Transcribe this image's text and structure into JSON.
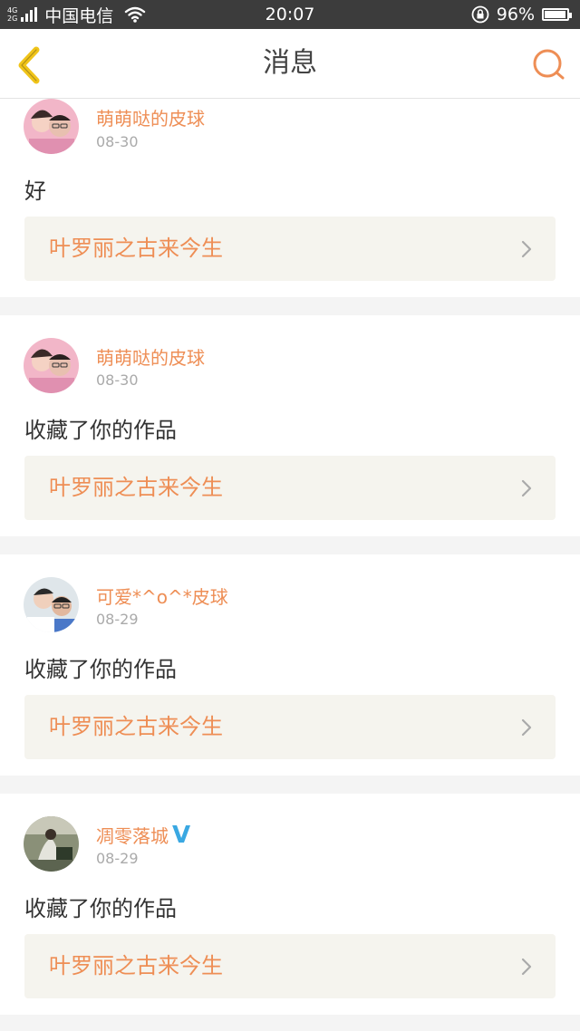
{
  "status_bar": {
    "network_top": "4G",
    "network_bottom": "2G",
    "carrier": "中国电信",
    "time": "20:07",
    "battery": "96%",
    "battery_level": 0.96
  },
  "header": {
    "title": "消息",
    "back_icon": "chevron-left-icon",
    "search_icon": "search-icon"
  },
  "colors": {
    "accent": "#ee8e55",
    "back_icon": "#f0c419",
    "verified": "#3aa8e2"
  },
  "messages": [
    {
      "username": "萌萌哒的皮球",
      "date": "08-30",
      "text": "好",
      "work_title": "叶罗丽之古来今生",
      "verified": false
    },
    {
      "username": "萌萌哒的皮球",
      "date": "08-30",
      "text": "收藏了你的作品",
      "work_title": "叶罗丽之古来今生",
      "verified": false
    },
    {
      "username": "可爱*^o^*皮球",
      "date": "08-29",
      "text": "收藏了你的作品",
      "work_title": "叶罗丽之古来今生",
      "verified": false
    },
    {
      "username": "凋零落城",
      "date": "08-29",
      "text": "收藏了你的作品",
      "work_title": "叶罗丽之古来今生",
      "verified": true,
      "verified_mark": "V"
    }
  ]
}
